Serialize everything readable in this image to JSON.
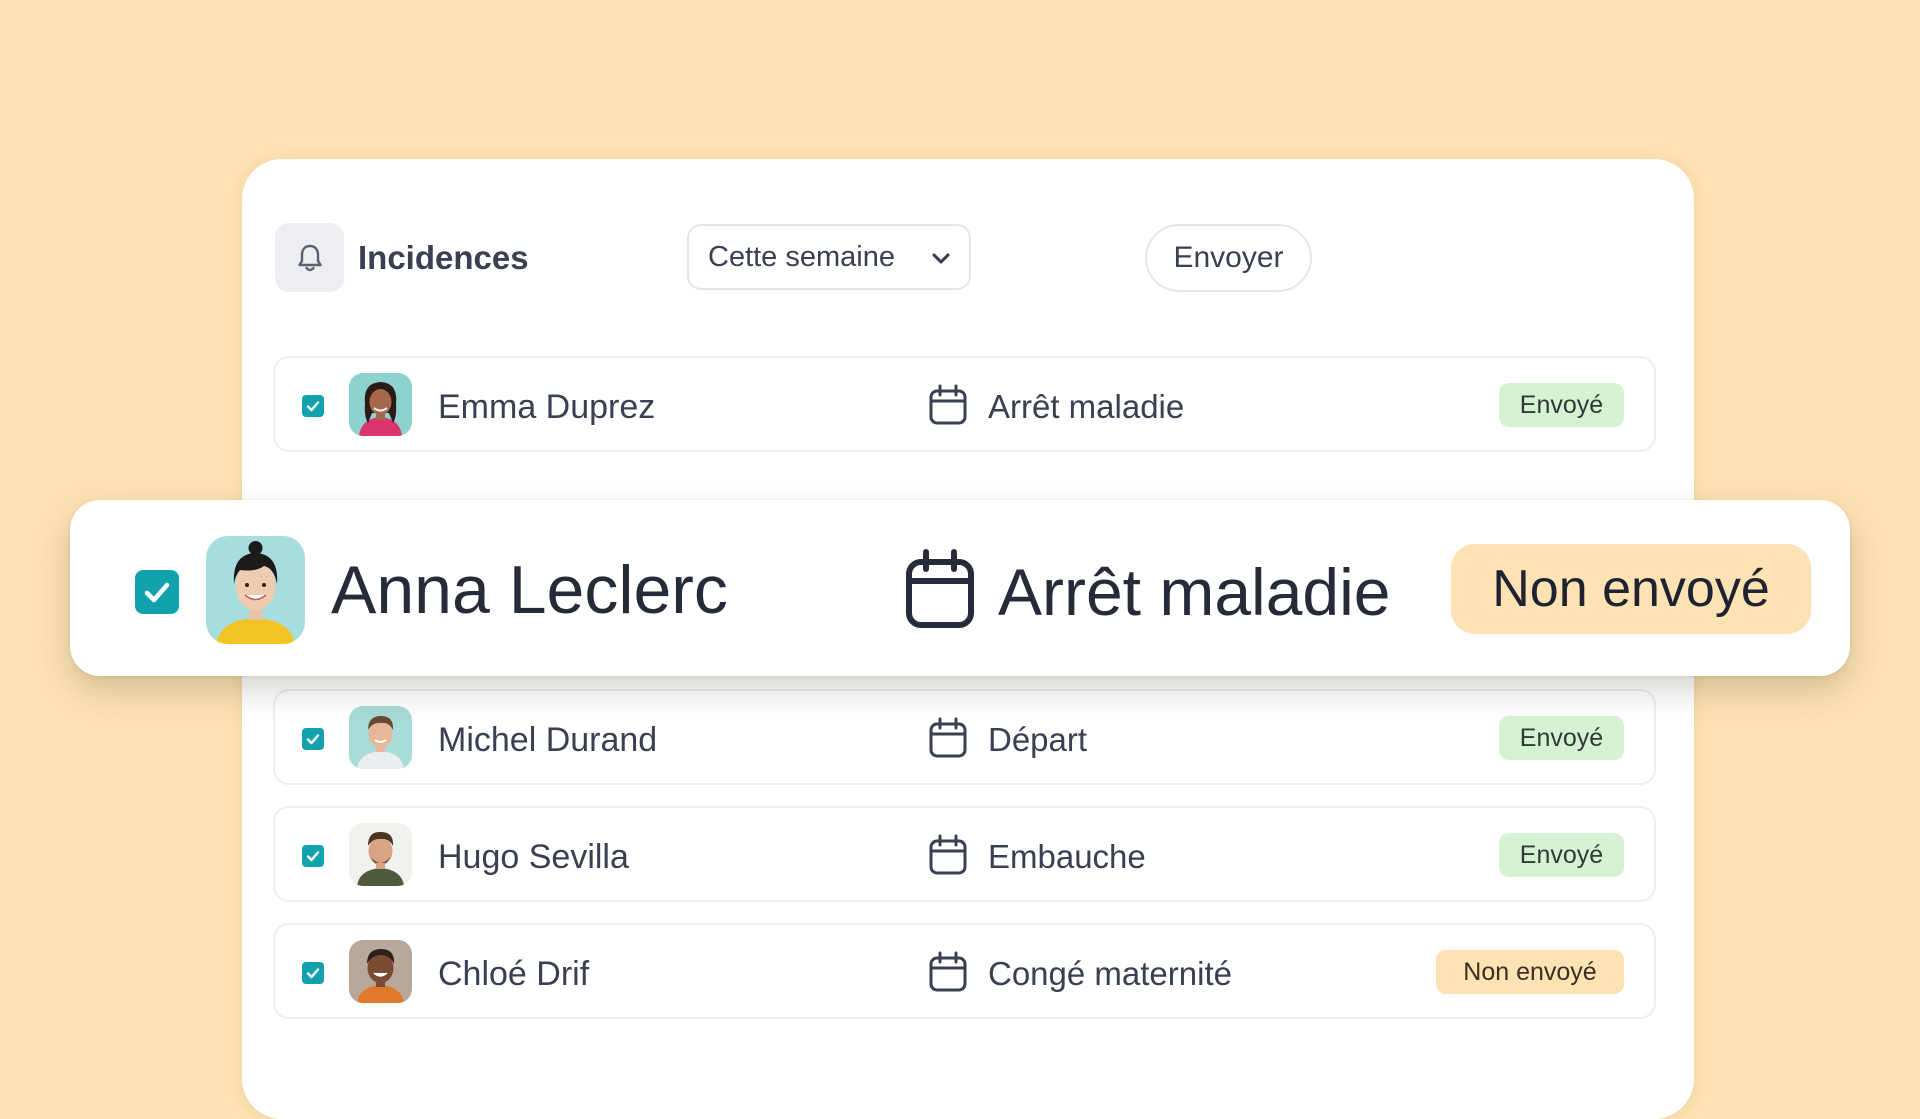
{
  "colors": {
    "background": "#fde2b3",
    "accent_checkbox": "#12a2ad",
    "badge_sent_bg": "#d5f3d3",
    "badge_not_sent_bg": "#fde2b3",
    "text": "#3a3f51"
  },
  "header": {
    "icon": "bell-icon",
    "title": "Incidences",
    "period_select": {
      "selected": "Cette semaine",
      "icon": "chevron-down-icon"
    },
    "send_label": "Envoyer"
  },
  "rows": [
    {
      "checked": true,
      "name": "Emma Duprez",
      "type_icon": "calendar-icon",
      "type": "Arrêt maladie",
      "status": "Envoyé"
    },
    {
      "checked": true,
      "name": "Michel Durand",
      "type_icon": "calendar-icon",
      "type": "Départ",
      "status": "Envoyé"
    },
    {
      "checked": true,
      "name": "Hugo Sevilla",
      "type_icon": "calendar-icon",
      "type": "Embauche",
      "status": "Envoyé"
    },
    {
      "checked": true,
      "name": "Chloé Drif",
      "type_icon": "calendar-icon",
      "type": "Congé maternité",
      "status": "Non envoyé"
    }
  ],
  "highlighted_row": {
    "checked": true,
    "name": "Anna Leclerc",
    "type_icon": "calendar-icon",
    "type": "Arrêt maladie",
    "status": "Non envoyé"
  }
}
